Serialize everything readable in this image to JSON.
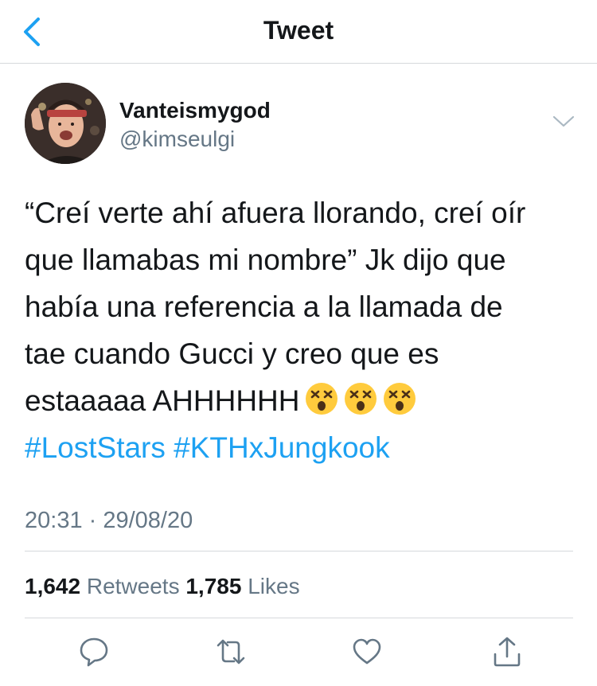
{
  "header": {
    "title": "Tweet",
    "back_icon": "chevron-left-icon",
    "accent": "#1da1f2"
  },
  "author": {
    "display_name": "Vanteismygod",
    "handle": "@kimseulgi"
  },
  "tweet": {
    "lines": [
      "“Creí verte ahí afuera llorando, creí oír",
      "que llamabas mi nombre” Jk dijo que",
      "había una referencia a la llamada de",
      "tae cuando Gucci y creo que es",
      "estaaaaa AHHHHHH"
    ],
    "emojis": [
      "dizzy-face-emoji",
      "dizzy-face-emoji",
      "dizzy-face-emoji"
    ],
    "hashtags": [
      "#LostStars",
      "#KTHxJungkook"
    ],
    "timestamp": "20:31 · 29/08/20"
  },
  "stats": {
    "retweets_count": "1,642",
    "retweets_label": "Retweets",
    "likes_count": "1,785",
    "likes_label": "Likes"
  },
  "actions": [
    "reply-icon",
    "retweet-icon",
    "like-icon",
    "share-icon"
  ]
}
